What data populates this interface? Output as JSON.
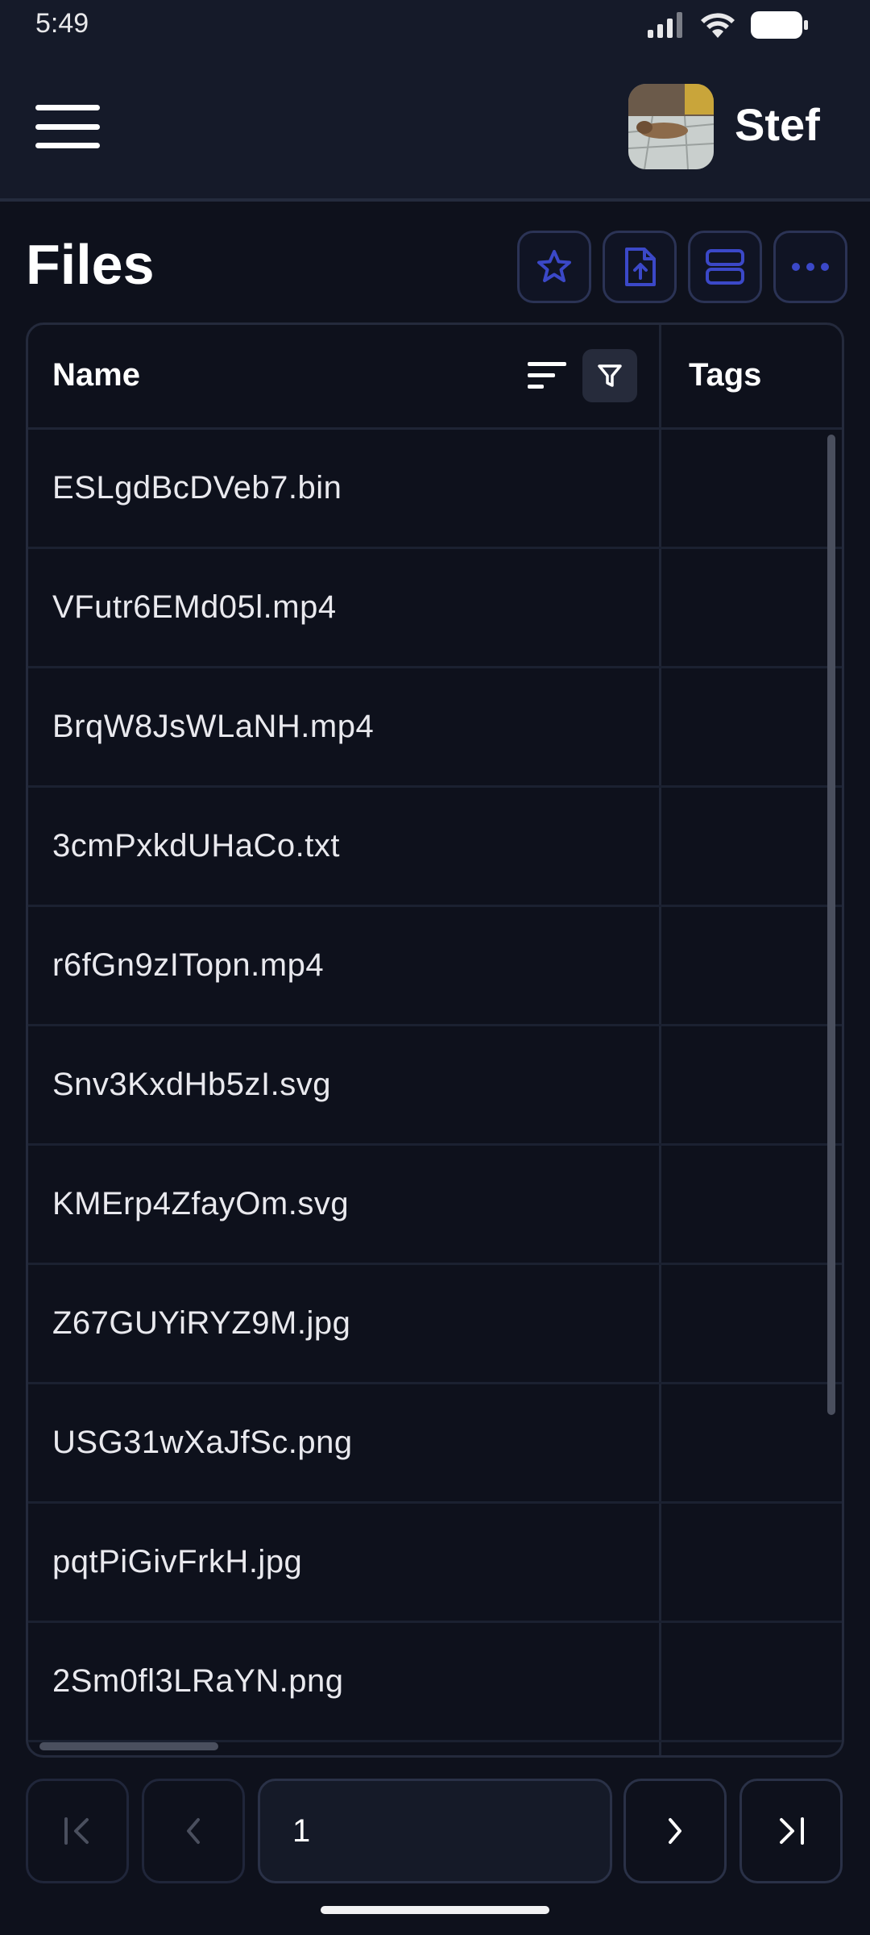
{
  "status_bar": {
    "time": "5:49"
  },
  "header": {
    "user_name": "Stef"
  },
  "page": {
    "title": "Files"
  },
  "toolbar": {
    "buttons": [
      "star-icon",
      "upload-file-icon",
      "view-layout-icon",
      "more-icon"
    ],
    "accent_color": "#3b48c8"
  },
  "table": {
    "columns": {
      "name": "Name",
      "tags": "Tags"
    },
    "rows": [
      {
        "name": "ESLgdBcDVeb7.bin",
        "tags": ""
      },
      {
        "name": "VFutr6EMd05l.mp4",
        "tags": ""
      },
      {
        "name": "BrqW8JsWLaNH.mp4",
        "tags": ""
      },
      {
        "name": "3cmPxkdUHaCo.txt",
        "tags": ""
      },
      {
        "name": "r6fGn9zITopn.mp4",
        "tags": ""
      },
      {
        "name": "Snv3KxdHb5zI.svg",
        "tags": ""
      },
      {
        "name": "KMErp4ZfayOm.svg",
        "tags": ""
      },
      {
        "name": "Z67GUYiRYZ9M.jpg",
        "tags": ""
      },
      {
        "name": "USG31wXaJfSc.png",
        "tags": ""
      },
      {
        "name": "pqtPiGivFrkH.jpg",
        "tags": ""
      },
      {
        "name": "2Sm0fl3LRaYN.png",
        "tags": ""
      }
    ]
  },
  "pagination": {
    "current_page": "1"
  }
}
